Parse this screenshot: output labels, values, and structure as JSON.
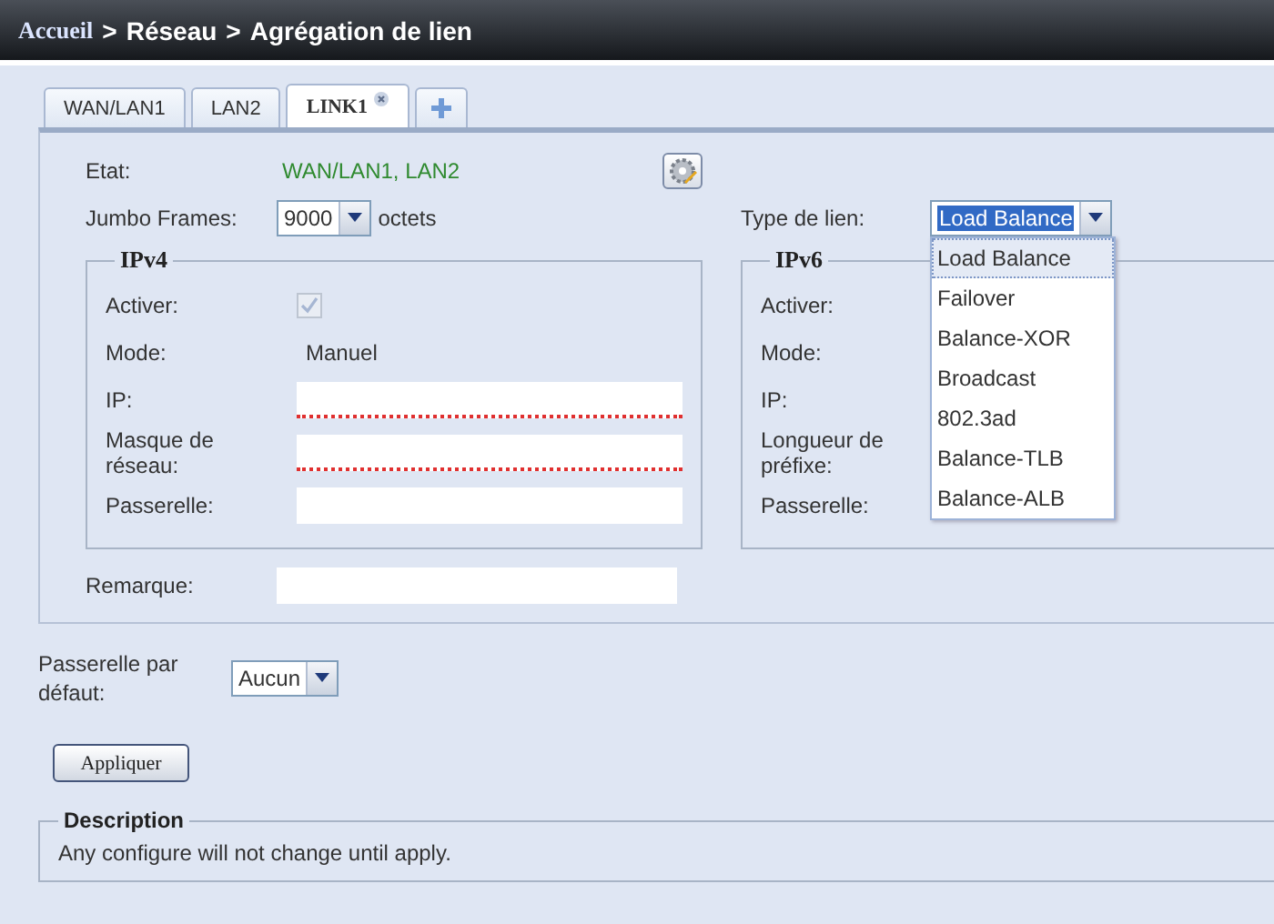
{
  "breadcrumb": {
    "items": [
      "Accueil",
      "Réseau",
      "Agrégation de lien"
    ],
    "separator": ">"
  },
  "tabs": [
    {
      "label": "WAN/LAN1",
      "selected": false,
      "closable": false
    },
    {
      "label": "LAN2",
      "selected": false,
      "closable": false
    },
    {
      "label": "LINK1",
      "selected": true,
      "closable": true
    }
  ],
  "status": {
    "label": "Etat:",
    "value": "WAN/LAN1, LAN2"
  },
  "jumbo_frames": {
    "label": "Jumbo Frames:",
    "value": "9000",
    "unit": "octets"
  },
  "link_type": {
    "label": "Type de lien:",
    "value": "Load Balance",
    "expanded": true,
    "options": [
      {
        "label": "Load Balance",
        "selected": true
      },
      {
        "label": "Failover",
        "selected": false
      },
      {
        "label": "Balance-XOR",
        "selected": false
      },
      {
        "label": "Broadcast",
        "selected": false
      },
      {
        "label": "802.3ad",
        "selected": false
      },
      {
        "label": "Balance-TLB",
        "selected": false
      },
      {
        "label": "Balance-ALB",
        "selected": false
      }
    ]
  },
  "ipv4": {
    "title": "IPv4",
    "rows": [
      {
        "label": "Activer:",
        "kind": "checkbox",
        "checked": true,
        "disabled": true
      },
      {
        "label": "Mode:",
        "kind": "text",
        "value": "Manuel"
      },
      {
        "label": "IP:",
        "kind": "input",
        "invalid": true
      },
      {
        "label": "Masque de réseau:",
        "kind": "input",
        "invalid": true
      },
      {
        "label": "Passerelle:",
        "kind": "input",
        "invalid": false
      }
    ]
  },
  "ipv6": {
    "title": "IPv6",
    "rows": [
      {
        "label": "Activer:"
      },
      {
        "label": "Mode:"
      },
      {
        "label": "IP:"
      },
      {
        "label": "Longueur de préfixe:"
      },
      {
        "label": "Passerelle:"
      }
    ]
  },
  "remark": {
    "label": "Remarque:"
  },
  "default_gateway": {
    "label": "Passerelle par défaut:",
    "value": "Aucun"
  },
  "apply_button": "Appliquer",
  "description": {
    "title": "Description",
    "text": "Any configure will not change until apply."
  }
}
